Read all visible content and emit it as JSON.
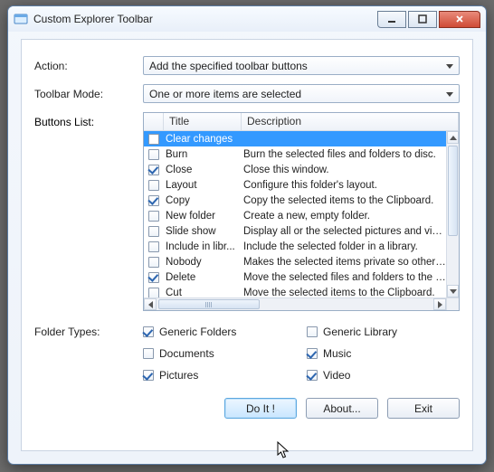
{
  "window": {
    "title": "Custom Explorer Toolbar"
  },
  "labels": {
    "action": "Action:",
    "toolbarMode": "Toolbar Mode:",
    "buttonsList": "Buttons List:",
    "folderTypes": "Folder Types:"
  },
  "combos": {
    "action": "Add the specified toolbar buttons",
    "toolbarMode": "One or more items are selected"
  },
  "list": {
    "headers": {
      "title": "Title",
      "description": "Description"
    },
    "rows": [
      {
        "checked": false,
        "selected": true,
        "title": "Clear changes",
        "desc": ""
      },
      {
        "checked": false,
        "selected": false,
        "title": "Burn",
        "desc": "Burn the selected files and folders to disc."
      },
      {
        "checked": true,
        "selected": false,
        "title": "Close",
        "desc": "Close this window."
      },
      {
        "checked": false,
        "selected": false,
        "title": "Layout",
        "desc": "Configure this folder's layout."
      },
      {
        "checked": true,
        "selected": false,
        "title": "Copy",
        "desc": "Copy the selected items to the Clipboard."
      },
      {
        "checked": false,
        "selected": false,
        "title": "New folder",
        "desc": "Create a new, empty folder."
      },
      {
        "checked": false,
        "selected": false,
        "title": "Slide show",
        "desc": "Display all or the selected pictures and videos i.."
      },
      {
        "checked": false,
        "selected": false,
        "title": "Include in libr...",
        "desc": "Include the selected folder in a library."
      },
      {
        "checked": false,
        "selected": false,
        "title": "Nobody",
        "desc": "Makes the selected items private so other peo..."
      },
      {
        "checked": true,
        "selected": false,
        "title": "Delete",
        "desc": "Move the selected files and folders to the Recy."
      },
      {
        "checked": false,
        "selected": false,
        "title": "Cut",
        "desc": "Move the selected items to the Clipboard."
      }
    ]
  },
  "folderTypes": [
    {
      "label": "Generic Folders",
      "checked": true
    },
    {
      "label": "Generic Library",
      "checked": false
    },
    {
      "label": "Documents",
      "checked": false
    },
    {
      "label": "Music",
      "checked": true
    },
    {
      "label": "Pictures",
      "checked": true
    },
    {
      "label": "Video",
      "checked": true
    }
  ],
  "buttons": {
    "doit": "Do It !",
    "about": "About...",
    "exit": "Exit"
  }
}
